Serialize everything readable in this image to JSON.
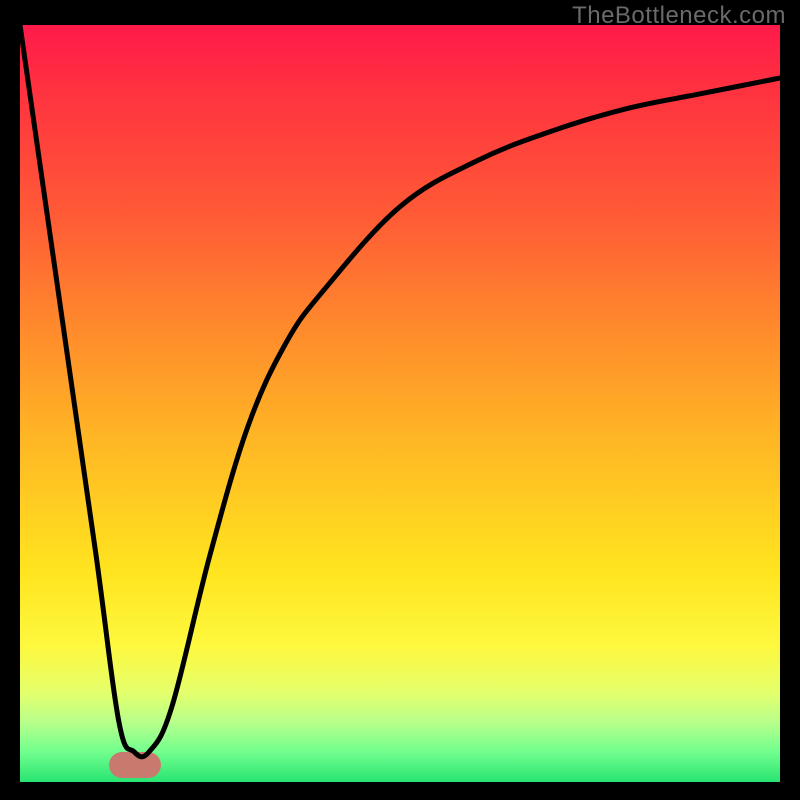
{
  "watermark": "TheBottleneck.com",
  "chart_data": {
    "type": "line",
    "title": "",
    "xlabel": "",
    "ylabel": "",
    "xlim": [
      0,
      100
    ],
    "ylim": [
      0,
      100
    ],
    "grid": false,
    "legend": false,
    "series": [
      {
        "name": "bottleneck-curve",
        "x": [
          0,
          5,
          10,
          13,
          15,
          17,
          20,
          25,
          30,
          35,
          40,
          50,
          60,
          70,
          80,
          90,
          100
        ],
        "values": [
          100,
          65,
          30,
          8,
          4,
          4,
          10,
          30,
          47,
          58,
          65,
          76,
          82,
          86,
          89,
          91,
          93
        ]
      }
    ],
    "annotations": [
      {
        "name": "minimum-marker",
        "x": 15.5,
        "y": 2,
        "color": "#c97a6e"
      }
    ],
    "gradient_stops": [
      {
        "pos": 0.0,
        "color": "#ff1a4a"
      },
      {
        "pos": 0.25,
        "color": "#ff5a36"
      },
      {
        "pos": 0.55,
        "color": "#ffb724"
      },
      {
        "pos": 0.82,
        "color": "#fef83e"
      },
      {
        "pos": 1.0,
        "color": "#28e472"
      }
    ]
  }
}
